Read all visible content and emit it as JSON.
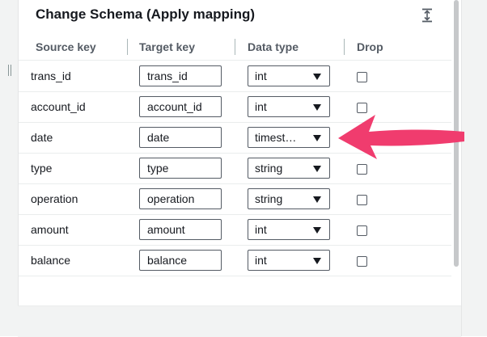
{
  "panel": {
    "title": "Change Schema (Apply mapping)",
    "collapse_icon": "collapse-vertical-icon"
  },
  "columns": {
    "source_key": "Source key",
    "target_key": "Target key",
    "data_type": "Data type",
    "drop": "Drop"
  },
  "rows": [
    {
      "source": "trans_id",
      "target": "trans_id",
      "type": "int",
      "drop": false
    },
    {
      "source": "account_id",
      "target": "account_id",
      "type": "int",
      "drop": false
    },
    {
      "source": "date",
      "target": "date",
      "type": "timest…",
      "drop": false
    },
    {
      "source": "type",
      "target": "type",
      "type": "string",
      "drop": false
    },
    {
      "source": "operation",
      "target": "operation",
      "type": "string",
      "drop": false
    },
    {
      "source": "amount",
      "target": "amount",
      "type": "int",
      "drop": false
    },
    {
      "source": "balance",
      "target": "balance",
      "type": "int",
      "drop": false
    }
  ],
  "annotation": {
    "icon": "pointer-arrow-icon",
    "color": "#f03c6e"
  }
}
